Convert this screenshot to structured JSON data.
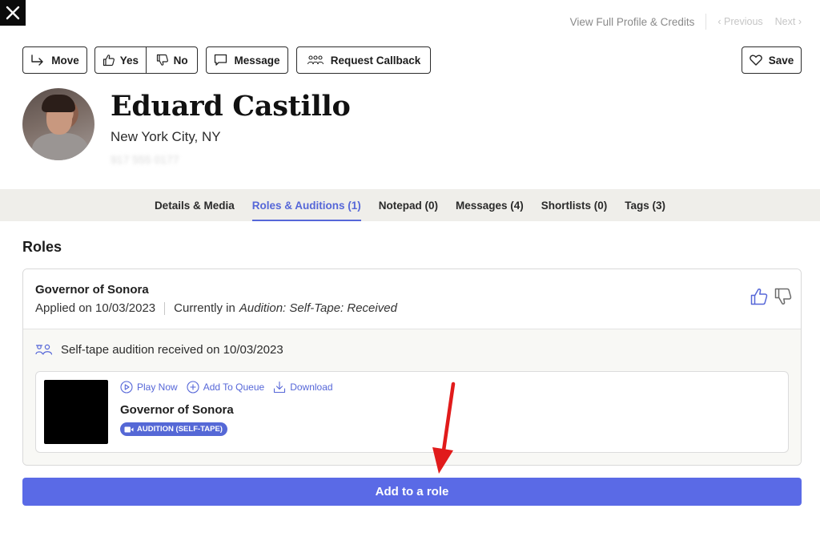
{
  "nav": {
    "full_profile": "View Full Profile & Credits",
    "previous": "‹ Previous",
    "next": "Next ›"
  },
  "actions": {
    "move": "Move",
    "yes": "Yes",
    "no": "No",
    "message": "Message",
    "request_callback": "Request Callback",
    "save": "Save"
  },
  "profile": {
    "name": "Eduard Castillo",
    "location": "New York City, NY",
    "phone": "917 555 0177"
  },
  "tabs": [
    {
      "label": "Details & Media",
      "active": false
    },
    {
      "label": "Roles & Auditions (1)",
      "active": true
    },
    {
      "label": "Notepad (0)",
      "active": false
    },
    {
      "label": "Messages (4)",
      "active": false
    },
    {
      "label": "Shortlists (0)",
      "active": false
    },
    {
      "label": "Tags (3)",
      "active": false
    }
  ],
  "roles": {
    "title": "Roles",
    "card": {
      "role_name": "Governor of Sonora",
      "applied": "Applied on 10/03/2023",
      "currently_in_prefix": "Currently in",
      "currently_in_status": "Audition: Self-Tape: Received",
      "tape_status": "Self-tape audition received on 10/03/2023",
      "media": {
        "play_now": "Play Now",
        "add_to_queue": "Add To Queue",
        "download": "Download",
        "title": "Governor of Sonora",
        "badge": "AUDITION (SELF-TAPE)"
      }
    },
    "add_button": "Add to a role"
  },
  "colors": {
    "accent": "#5667d8",
    "primary_button": "#5a6ae6",
    "annotation_arrow": "#e11b1b"
  }
}
